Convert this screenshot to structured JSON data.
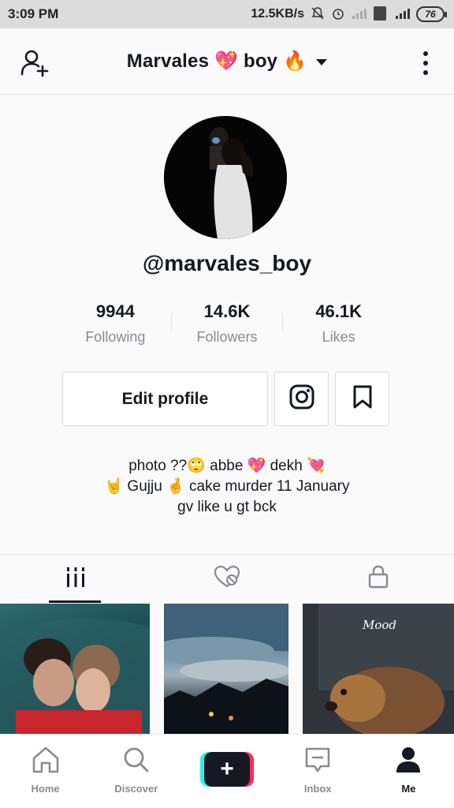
{
  "status_bar": {
    "time": "3:09 PM",
    "speed": "12.5KB/s",
    "battery": "76"
  },
  "header": {
    "title": "Marvales 💖 boy 🔥"
  },
  "profile": {
    "username": "@marvales_boy",
    "stats": [
      {
        "value": "9944",
        "label": "Following"
      },
      {
        "value": "14.6K",
        "label": "Followers"
      },
      {
        "value": "46.1K",
        "label": "Likes"
      }
    ],
    "edit_label": "Edit profile",
    "bio": [
      "photo ??🙄 abbe 💖 dekh 💘",
      "🤘 Gujju 🤞 cake murder 11 January",
      "gv like u gt bck"
    ]
  },
  "thumbnails": {
    "third_caption": "Mood"
  },
  "bottom_nav": {
    "items": [
      {
        "label": "Home"
      },
      {
        "label": "Discover"
      },
      {
        "label": "Inbox"
      },
      {
        "label": "Me"
      }
    ],
    "create_symbol": "+"
  },
  "colors": {
    "accent_red": "#fe2c55",
    "accent_cyan": "#25f4ee",
    "text_primary": "#161823",
    "text_secondary": "#8a8b91"
  }
}
